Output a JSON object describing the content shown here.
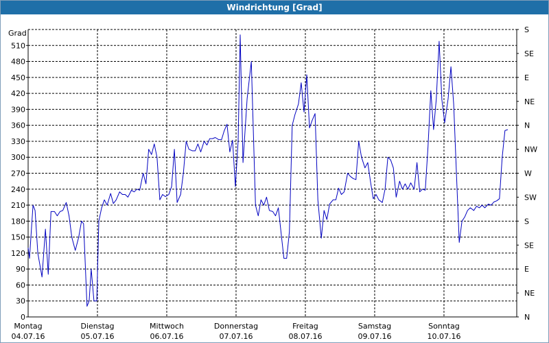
{
  "window": {
    "title": "Windrichtung [Grad]"
  },
  "chart_data": {
    "type": "line",
    "title": "Windrichtung [Grad]",
    "ylabel": "Grad",
    "ylim": [
      0,
      540
    ],
    "xlim": [
      0,
      7.05
    ],
    "yticks": [
      0,
      30,
      60,
      90,
      120,
      150,
      180,
      210,
      240,
      270,
      300,
      330,
      360,
      390,
      420,
      450,
      480,
      510
    ],
    "right_ticks": [
      {
        "value": 0,
        "label": "N"
      },
      {
        "value": 45,
        "label": "NE"
      },
      {
        "value": 90,
        "label": "E"
      },
      {
        "value": 135,
        "label": "SE"
      },
      {
        "value": 180,
        "label": "S"
      },
      {
        "value": 225,
        "label": "SW"
      },
      {
        "value": 270,
        "label": "W"
      },
      {
        "value": 315,
        "label": "NW"
      },
      {
        "value": 360,
        "label": "N"
      },
      {
        "value": 405,
        "label": "NE"
      },
      {
        "value": 450,
        "label": "E"
      },
      {
        "value": 495,
        "label": "SE"
      },
      {
        "value": 540,
        "label": "S"
      }
    ],
    "x_labels": [
      {
        "day": "Montag",
        "date": "04.07.16"
      },
      {
        "day": "Dienstag",
        "date": "05.07.16"
      },
      {
        "day": "Mittwoch",
        "date": "06.07.16"
      },
      {
        "day": "Donnerstag",
        "date": "07.07.16"
      },
      {
        "day": "Freitag",
        "date": "08.07.16"
      },
      {
        "day": "Samstag",
        "date": "09.07.16"
      },
      {
        "day": "Sonntag",
        "date": "10.07.16"
      }
    ],
    "grid": true,
    "series": [
      {
        "color": "#0000c0",
        "points": [
          [
            0.0,
            130
          ],
          [
            0.02,
            110
          ],
          [
            0.07,
            210
          ],
          [
            0.1,
            200
          ],
          [
            0.14,
            120
          ],
          [
            0.2,
            75
          ],
          [
            0.25,
            165
          ],
          [
            0.29,
            80
          ],
          [
            0.33,
            198
          ],
          [
            0.38,
            198
          ],
          [
            0.42,
            190
          ],
          [
            0.46,
            198
          ],
          [
            0.5,
            200
          ],
          [
            0.55,
            215
          ],
          [
            0.59,
            190
          ],
          [
            0.63,
            150
          ],
          [
            0.68,
            125
          ],
          [
            0.73,
            150
          ],
          [
            0.77,
            180
          ],
          [
            0.8,
            175
          ],
          [
            0.85,
            20
          ],
          [
            0.88,
            30
          ],
          [
            0.91,
            90
          ],
          [
            0.95,
            30
          ],
          [
            0.99,
            30
          ],
          [
            1.02,
            180
          ],
          [
            1.06,
            205
          ],
          [
            1.1,
            220
          ],
          [
            1.14,
            210
          ],
          [
            1.19,
            232
          ],
          [
            1.23,
            213
          ],
          [
            1.27,
            220
          ],
          [
            1.32,
            235
          ],
          [
            1.36,
            230
          ],
          [
            1.4,
            230
          ],
          [
            1.44,
            225
          ],
          [
            1.49,
            238
          ],
          [
            1.53,
            235
          ],
          [
            1.57,
            240
          ],
          [
            1.61,
            238
          ],
          [
            1.66,
            270
          ],
          [
            1.7,
            250
          ],
          [
            1.74,
            315
          ],
          [
            1.78,
            305
          ],
          [
            1.82,
            325
          ],
          [
            1.86,
            300
          ],
          [
            1.9,
            220
          ],
          [
            1.94,
            230
          ],
          [
            1.98,
            226
          ],
          [
            2.03,
            230
          ],
          [
            2.07,
            245
          ],
          [
            2.11,
            315
          ],
          [
            2.15,
            215
          ],
          [
            2.2,
            230
          ],
          [
            2.24,
            270
          ],
          [
            2.28,
            330
          ],
          [
            2.32,
            315
          ],
          [
            2.37,
            312
          ],
          [
            2.41,
            312
          ],
          [
            2.45,
            325
          ],
          [
            2.49,
            310
          ],
          [
            2.54,
            330
          ],
          [
            2.58,
            323
          ],
          [
            2.62,
            335
          ],
          [
            2.66,
            335
          ],
          [
            2.7,
            337
          ],
          [
            2.75,
            333
          ],
          [
            2.79,
            333
          ],
          [
            2.83,
            350
          ],
          [
            2.87,
            362
          ],
          [
            2.91,
            310
          ],
          [
            2.95,
            332
          ],
          [
            2.99,
            245
          ],
          [
            3.03,
            330
          ],
          [
            3.06,
            530
          ],
          [
            3.1,
            290
          ],
          [
            3.16,
            410
          ],
          [
            3.22,
            480
          ],
          [
            3.28,
            210
          ],
          [
            3.32,
            190
          ],
          [
            3.36,
            220
          ],
          [
            3.4,
            210
          ],
          [
            3.44,
            225
          ],
          [
            3.48,
            200
          ],
          [
            3.53,
            198
          ],
          [
            3.57,
            190
          ],
          [
            3.61,
            205
          ],
          [
            3.65,
            158
          ],
          [
            3.69,
            110
          ],
          [
            3.73,
            110
          ],
          [
            3.77,
            160
          ],
          [
            3.81,
            360
          ],
          [
            3.85,
            380
          ],
          [
            3.9,
            400
          ],
          [
            3.94,
            440
          ],
          [
            3.98,
            385
          ],
          [
            4.02,
            455
          ],
          [
            4.06,
            355
          ],
          [
            4.1,
            370
          ],
          [
            4.14,
            382
          ],
          [
            4.18,
            220
          ],
          [
            4.23,
            148
          ],
          [
            4.27,
            200
          ],
          [
            4.31,
            183
          ],
          [
            4.35,
            212
          ],
          [
            4.4,
            220
          ],
          [
            4.44,
            220
          ],
          [
            4.48,
            242
          ],
          [
            4.52,
            230
          ],
          [
            4.56,
            235
          ],
          [
            4.61,
            270
          ],
          [
            4.65,
            264
          ],
          [
            4.69,
            260
          ],
          [
            4.73,
            258
          ],
          [
            4.77,
            330
          ],
          [
            4.81,
            300
          ],
          [
            4.86,
            280
          ],
          [
            4.9,
            290
          ],
          [
            4.94,
            254
          ],
          [
            4.98,
            222
          ],
          [
            5.02,
            230
          ],
          [
            5.06,
            220
          ],
          [
            5.11,
            215
          ],
          [
            5.15,
            240
          ],
          [
            5.19,
            300
          ],
          [
            5.23,
            295
          ],
          [
            5.27,
            280
          ],
          [
            5.31,
            225
          ],
          [
            5.36,
            255
          ],
          [
            5.4,
            240
          ],
          [
            5.44,
            250
          ],
          [
            5.48,
            240
          ],
          [
            5.52,
            252
          ],
          [
            5.57,
            240
          ],
          [
            5.61,
            290
          ],
          [
            5.65,
            235
          ],
          [
            5.69,
            240
          ],
          [
            5.73,
            238
          ],
          [
            5.77,
            320
          ],
          [
            5.81,
            425
          ],
          [
            5.85,
            352
          ],
          [
            5.89,
            410
          ],
          [
            5.93,
            518
          ],
          [
            5.97,
            408
          ],
          [
            6.01,
            365
          ],
          [
            6.06,
            410
          ],
          [
            6.1,
            470
          ],
          [
            6.14,
            400
          ],
          [
            6.18,
            270
          ],
          [
            6.22,
            140
          ],
          [
            6.26,
            180
          ],
          [
            6.3,
            188
          ],
          [
            6.34,
            200
          ],
          [
            6.38,
            205
          ],
          [
            6.43,
            200
          ],
          [
            6.47,
            208
          ],
          [
            6.51,
            205
          ],
          [
            6.55,
            210
          ],
          [
            6.59,
            205
          ],
          [
            6.64,
            212
          ],
          [
            6.68,
            210
          ],
          [
            6.72,
            216
          ],
          [
            6.76,
            218
          ],
          [
            6.8,
            222
          ],
          [
            6.84,
            300
          ],
          [
            6.88,
            350
          ],
          [
            6.92,
            352
          ]
        ]
      }
    ]
  }
}
